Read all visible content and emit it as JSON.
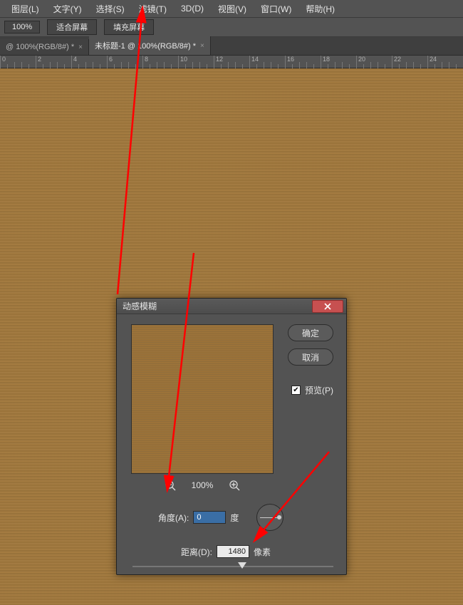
{
  "menubar": {
    "items": [
      "图层(L)",
      "文字(Y)",
      "选择(S)",
      "滤镜(T)",
      "3D(D)",
      "视图(V)",
      "窗口(W)",
      "帮助(H)"
    ]
  },
  "toolbar": {
    "zoom": "100%",
    "fit_screen": "适合屏幕",
    "fill_screen": "填充屏幕"
  },
  "tabs": [
    {
      "label": "@ 100%(RGB/8#) *"
    },
    {
      "label": "未标题-1 @ 100%(RGB/8#) *"
    }
  ],
  "ruler": {
    "ticks": [
      0,
      2,
      4,
      6,
      8,
      10,
      12,
      14,
      16,
      18,
      20,
      22,
      24
    ]
  },
  "dialog": {
    "title": "动感模糊",
    "ok": "确定",
    "cancel": "取消",
    "preview_label": "预览(P)",
    "preview_checked": true,
    "zoom_label": "100%",
    "angle_label": "角度(A):",
    "angle_value": "0",
    "angle_unit": "度",
    "distance_label": "距离(D):",
    "distance_value": "1480",
    "distance_unit": "像素"
  }
}
